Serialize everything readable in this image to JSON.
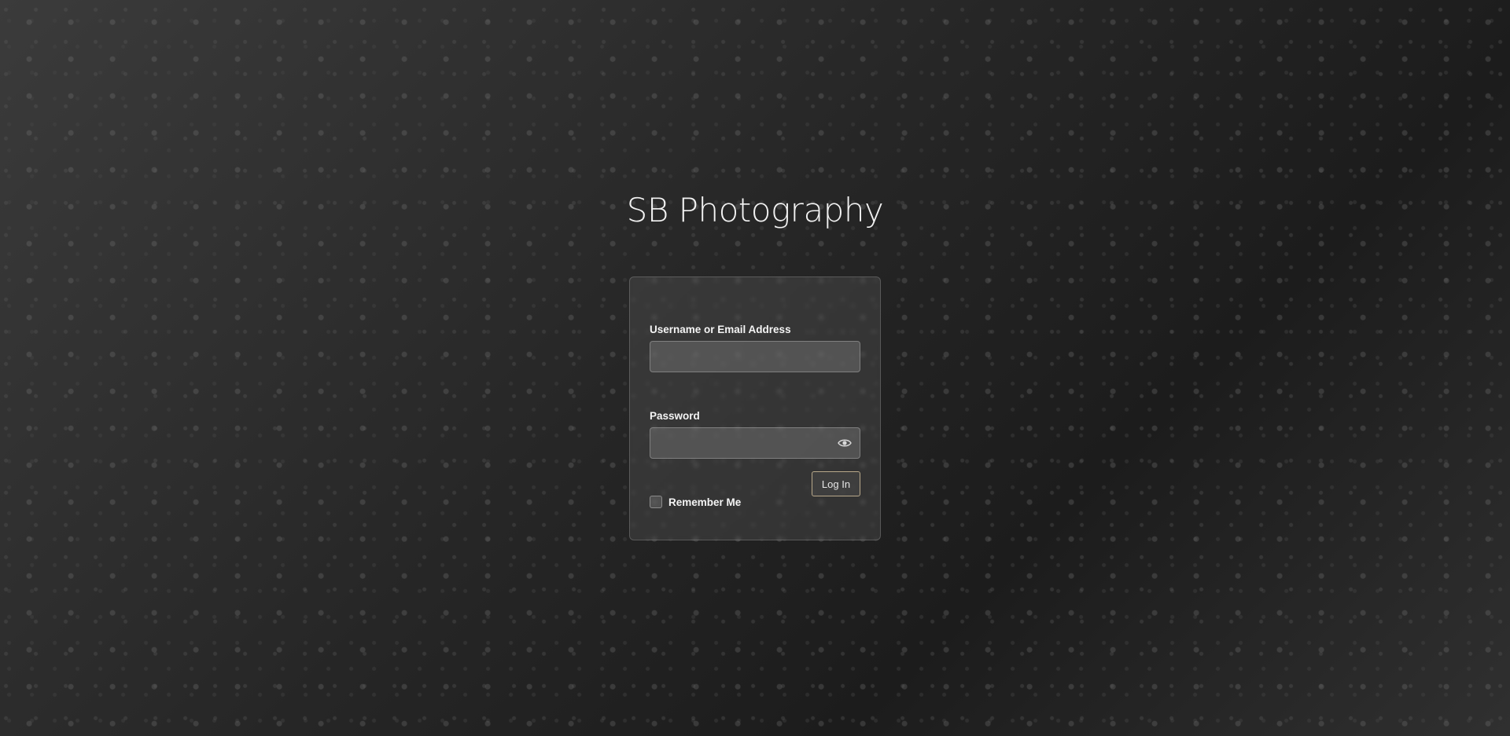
{
  "site": {
    "title": "SB Photography"
  },
  "login_form": {
    "username_label": "Username or Email Address",
    "username_value": "",
    "password_label": "Password",
    "password_value": "",
    "remember_label": "Remember Me",
    "remember_checked": false,
    "submit_label": "Log In",
    "show_password_icon": "eye-icon"
  },
  "colors": {
    "text": "#f4f4f4",
    "button_border": "#b8a88a"
  }
}
